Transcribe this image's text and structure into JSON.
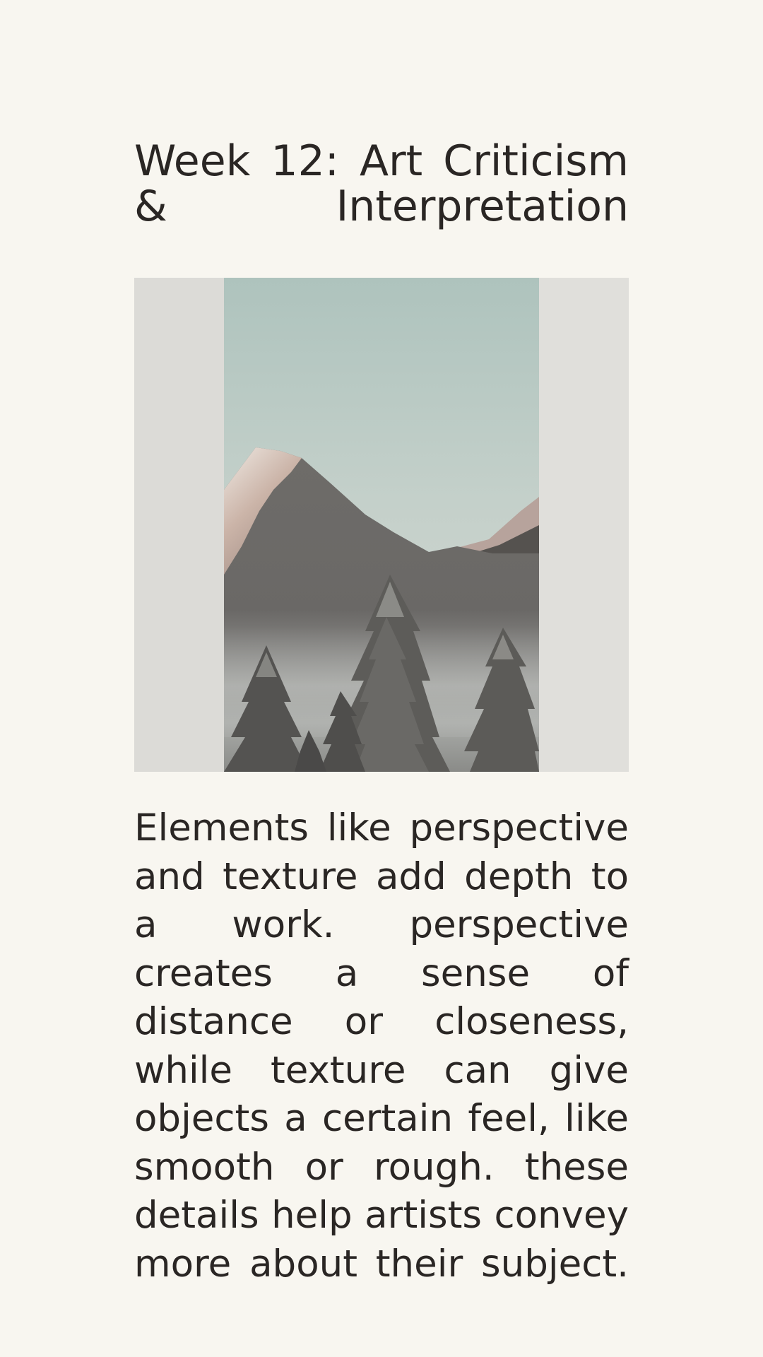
{
  "slide": {
    "title_lines": [
      "Week 12: Art Criticism",
      "& Interpretation"
    ],
    "image": {
      "subject": "mountain-forest-painting",
      "colors": {
        "sky_top": "#aec3bd",
        "sky_bottom": "#d6d8d2",
        "mountain": "#6b6966",
        "snow": "#e6ded6",
        "trees": "#4d4c4a",
        "mat": "#dcdbd7"
      }
    },
    "body_lines": [
      "Elements like perspective",
      "and texture add depth to",
      "a work. perspective",
      "creates a sense of",
      "distance or closeness,",
      "while texture can give",
      "objects a certain feel, like",
      "smooth or rough. these",
      "details help artists convey",
      "more about their subject."
    ]
  }
}
